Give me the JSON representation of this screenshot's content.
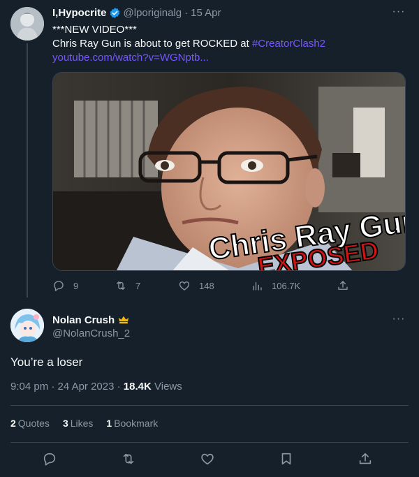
{
  "parent_tweet": {
    "author_name": "I,Hypocrite",
    "handle": "@lporiginalg",
    "separator": "·",
    "date": "15 Apr",
    "line1": "***NEW VIDEO***",
    "line2_prefix": "Chris Ray Gun is about to get ROCKED at ",
    "hashtag": "#CreatorClash2",
    "link": "youtube.com/watch?v=WGNptb...",
    "thumbnail": {
      "title": "Chris Ray Gun",
      "subtitle": "EXPOSED"
    },
    "actions": {
      "replies": "9",
      "retweets": "7",
      "likes": "148",
      "views": "106.7K"
    }
  },
  "reply_tweet": {
    "author_name": "Nolan Crush",
    "handle": "@NolanCrush_2",
    "text": "You’re a loser",
    "time": "9:04 pm",
    "date": "24 Apr 2023",
    "separator": "·",
    "views_count": "18.4K",
    "views_label": "Views",
    "stats": {
      "quotes_count": "2",
      "quotes_label": "Quotes",
      "likes_count": "3",
      "likes_label": "Likes",
      "bookmarks_count": "1",
      "bookmarks_label": "Bookmark"
    }
  },
  "colors": {
    "background": "#15202b",
    "text": "#f7f9f9",
    "muted": "#8b98a5",
    "link": "#1d9bf0",
    "hashtag": "#7856ff",
    "verified": "#1d9bf0",
    "thumbnail_text_red": "#d11414"
  },
  "icons": [
    "verified-badge-icon",
    "more-icon",
    "reply-icon",
    "retweet-icon",
    "like-icon",
    "views-icon",
    "share-icon",
    "crown-badge-icon",
    "bookmark-icon"
  ]
}
